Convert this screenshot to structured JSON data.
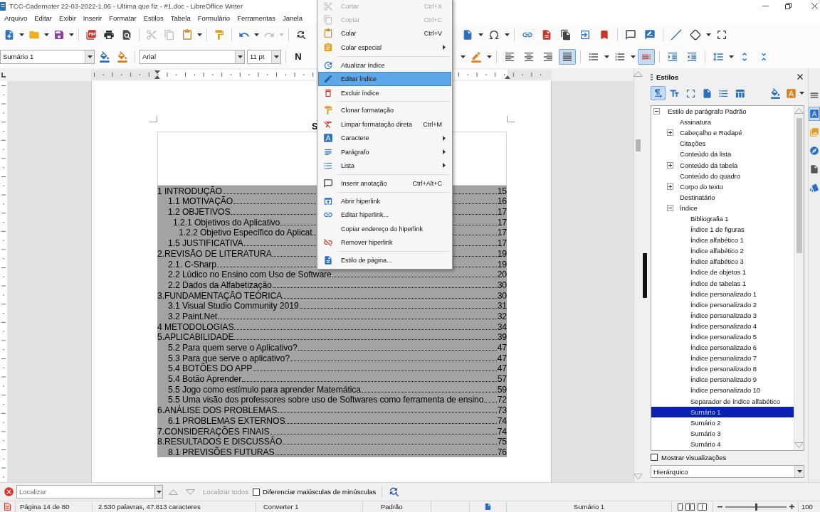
{
  "window": {
    "title": "TCC-Cadernoter 22-03-2022-1.06 - Ultima que fiz - #1.doc - LibreOffice Writer"
  },
  "menu_bar": [
    "Arquivo",
    "Editar",
    "Exibir",
    "Inserir",
    "Formatar",
    "Estilos",
    "Tabela",
    "Formulário",
    "Ferramentas",
    "Janela"
  ],
  "standard_toolbar": {
    "left_groups": [
      [
        {
          "kind": "new",
          "disabled": false
        },
        {
          "kind": "open",
          "disabled": false
        },
        {
          "kind": "save",
          "disabled": false
        }
      ],
      [
        {
          "kind": "export-pdf",
          "disabled": false
        },
        {
          "kind": "print",
          "disabled": false
        },
        {
          "kind": "print-preview",
          "disabled": false
        }
      ],
      [
        {
          "kind": "cut",
          "disabled": true
        },
        {
          "kind": "copy",
          "disabled": true
        },
        {
          "kind": "paste",
          "disabled": false
        }
      ],
      [
        {
          "kind": "clone-formatting",
          "disabled": false
        }
      ],
      [
        {
          "kind": "undo",
          "disabled": false
        },
        {
          "kind": "redo",
          "disabled": true
        }
      ],
      [
        {
          "kind": "find-replace",
          "disabled": false
        }
      ]
    ],
    "right_groups": [
      [
        {
          "kind": "insert-field",
          "disabled": false
        },
        {
          "kind": "special-character",
          "disabled": false
        }
      ],
      [
        {
          "kind": "hyperlink",
          "disabled": false
        },
        {
          "kind": "footnote",
          "disabled": false
        },
        {
          "kind": "endnote",
          "disabled": false
        },
        {
          "kind": "cross-reference",
          "disabled": false
        },
        {
          "kind": "bookmark",
          "disabled": false
        }
      ],
      [
        {
          "kind": "comment",
          "disabled": false
        },
        {
          "kind": "track-changes",
          "disabled": false
        }
      ],
      [
        {
          "kind": "line",
          "disabled": false
        },
        {
          "kind": "shapes",
          "disabled": false
        },
        {
          "kind": "frame",
          "disabled": false
        }
      ]
    ]
  },
  "formatting_toolbar": {
    "paragraph_style": "Sumário 1",
    "style_buttons": [
      {
        "kind": "update-style",
        "disabled": false
      },
      {
        "kind": "new-style",
        "disabled": false
      }
    ],
    "font_name": "Arial",
    "font_size": "11 pt",
    "bold": {
      "label": "N",
      "selected": false
    },
    "right_groups": [
      [
        {
          "kind": "highlight",
          "selected": false
        }
      ],
      [
        {
          "kind": "align-left",
          "selected": false
        },
        {
          "kind": "align-center",
          "selected": false
        },
        {
          "kind": "align-right",
          "selected": false
        },
        {
          "kind": "justify",
          "selected": true
        }
      ],
      [
        {
          "kind": "bullets",
          "selected": false
        },
        {
          "kind": "numbering",
          "selected": false
        },
        {
          "kind": "outline",
          "selected": true
        }
      ],
      [
        {
          "kind": "indent-increase",
          "selected": false
        },
        {
          "kind": "indent-decrease",
          "selected": false
        }
      ],
      [
        {
          "kind": "line-spacing",
          "selected": false
        },
        {
          "kind": "spacing-increase",
          "selected": false
        },
        {
          "kind": "spacing-decrease",
          "selected": false
        }
      ]
    ]
  },
  "document": {
    "heading": "S",
    "toc": [
      {
        "text": "1 INTRODUÇÃO",
        "page": "15",
        "children": [
          {
            "text": "1.1 MOTIVAÇÃO",
            "page": "16"
          },
          {
            "text": "1.2 OBJETIVOS",
            "page": "17",
            "children": [
              {
                "text": "1.2.1 Objetivos do Aplicativo",
                "page": "17",
                "children": [
                  {
                    "text": "1.2.2 Objetivo Específico do Aplicat",
                    "page": "17"
                  }
                ]
              }
            ]
          },
          {
            "text": "1.5 JUSTIFICATIVA",
            "page": "17"
          }
        ]
      },
      {
        "text": "2.REVISÃO DE LITERATURA",
        "page": "19",
        "children": [
          {
            "text": "2.1. C-Sharp",
            "page": "19"
          },
          {
            "text": "2.2 Lúdico no Ensino com Uso de Software",
            "page": "20"
          },
          {
            "text": "2.2 Dados da Alfabetização",
            "page": "30"
          }
        ]
      },
      {
        "text": "3.FUNDAMENTAÇÃO TEÓRICA",
        "page": "30",
        "children": [
          {
            "text": "3.1 Visual Studio Community 2019",
            "page": "31"
          },
          {
            "text": "3.2 Paint.Net",
            "page": "32"
          }
        ]
      },
      {
        "text": "4 METODOLOGIAS",
        "page": "34"
      },
      {
        "text": "5.APLICABILIDADE",
        "page": "39",
        "children": [
          {
            "text": "5.2 Para quem serve o Aplicativo?",
            "page": "47"
          },
          {
            "text": "5.3 Para que serve o aplicativo?",
            "page": "47"
          },
          {
            "text": "5.4 BOTÕES DO APP",
            "page": "47"
          },
          {
            "text": "5.4 Botão Aprender",
            "page": "57"
          },
          {
            "text": "5.5 Jogo como estímulo para aprender Matemática",
            "page": "59"
          },
          {
            "text": "5.5 Uma visão dos professores sobre uso de Softwares como ferramenta de ensino",
            "page": "72"
          }
        ]
      },
      {
        "text": "6.ANÁLISE DOS PROBLEMAS",
        "page": "73",
        "children": [
          {
            "text": "6.1 PROBLEMAS EXTERNOS",
            "page": "74"
          }
        ]
      },
      {
        "text": "7.CONSIDERAÇÕES FINAIS",
        "page": "74"
      },
      {
        "text": "8.RESULTADOS E DISCUSSÃO",
        "page": "75",
        "children": [
          {
            "text": "8.1 PREVISÕES FUTURAS",
            "page": "76"
          }
        ]
      }
    ]
  },
  "context_menu": {
    "items": [
      {
        "kind": "item",
        "label": "Cortar",
        "shortcut": "Ctrl+X",
        "submenu": false,
        "disabled": true,
        "selected": false
      },
      {
        "kind": "item",
        "label": "Copiar",
        "shortcut": "Ctrl+C",
        "submenu": false,
        "disabled": true,
        "selected": false
      },
      {
        "kind": "item",
        "label": "Colar",
        "shortcut": "Ctrl+V",
        "submenu": false,
        "disabled": false,
        "selected": false
      },
      {
        "kind": "item",
        "label": "Colar especial",
        "submenu": true,
        "disabled": false,
        "selected": false
      },
      {
        "kind": "separator"
      },
      {
        "kind": "item",
        "label": "Atualizar índice",
        "submenu": false,
        "disabled": false,
        "selected": false
      },
      {
        "kind": "item",
        "label": "Editar índice",
        "submenu": false,
        "disabled": false,
        "selected": true
      },
      {
        "kind": "item",
        "label": "Excluir índice",
        "submenu": false,
        "disabled": false,
        "selected": false
      },
      {
        "kind": "separator"
      },
      {
        "kind": "item",
        "label": "Clonar formatação",
        "submenu": false,
        "disabled": false,
        "selected": false
      },
      {
        "kind": "item",
        "label": "Limpar formatação direta",
        "shortcut": "Ctrl+M",
        "submenu": false,
        "disabled": false,
        "selected": false
      },
      {
        "kind": "item",
        "label": "Caractere",
        "submenu": true,
        "disabled": false,
        "selected": false
      },
      {
        "kind": "item",
        "label": "Parágrafo",
        "submenu": true,
        "disabled": false,
        "selected": false
      },
      {
        "kind": "item",
        "label": "Lista",
        "submenu": true,
        "disabled": false,
        "selected": false
      },
      {
        "kind": "separator"
      },
      {
        "kind": "item",
        "label": "Inserir anotação",
        "shortcut": "Ctrl+Alt+C",
        "submenu": false,
        "disabled": false,
        "selected": false
      },
      {
        "kind": "separator"
      },
      {
        "kind": "item",
        "label": "Abrir hiperlink",
        "submenu": false,
        "disabled": false,
        "selected": false
      },
      {
        "kind": "item",
        "label": "Editar hiperlink...",
        "submenu": false,
        "disabled": false,
        "selected": false
      },
      {
        "kind": "item",
        "label": "Copiar endereço do hiperlink",
        "submenu": false,
        "disabled": false,
        "selected": false
      },
      {
        "kind": "item",
        "label": "Remover hiperlink",
        "submenu": false,
        "disabled": false,
        "selected": false
      },
      {
        "kind": "separator"
      },
      {
        "kind": "item",
        "label": "Estilo de página...",
        "submenu": false,
        "disabled": false,
        "selected": false
      }
    ]
  },
  "styles_panel": {
    "title": "Estilos",
    "families": [
      {
        "kind": "paragraph",
        "selected": true
      },
      {
        "kind": "character",
        "selected": false
      },
      {
        "kind": "frame",
        "selected": false
      },
      {
        "kind": "page",
        "selected": false
      },
      {
        "kind": "list",
        "selected": false
      },
      {
        "kind": "table",
        "selected": false
      }
    ],
    "tree": [
      {
        "label": "Estilo de parágrafo Padrão",
        "expanded": true,
        "selected": false,
        "children": [
          {
            "label": "Assinatura",
            "selected": false
          },
          {
            "label": "Cabeçalho e Rodapé",
            "expanded": false,
            "selected": false
          },
          {
            "label": "Citações",
            "selected": false
          },
          {
            "label": "Conteúdo da lista",
            "selected": false
          },
          {
            "label": "Conteúdo da tabela",
            "expanded": false,
            "selected": false
          },
          {
            "label": "Conteúdo do quadro",
            "selected": false
          },
          {
            "label": "Corpo do texto",
            "expanded": false,
            "selected": false
          },
          {
            "label": "Destinatário",
            "selected": false
          },
          {
            "label": "Índice",
            "expanded": true,
            "selected": false,
            "children": [
              {
                "label": "Bibliografia 1",
                "selected": false
              },
              {
                "label": "Índice 1 de figuras",
                "selected": false
              },
              {
                "label": "Índice alfabético 1",
                "selected": false
              },
              {
                "label": "Índice alfabético 2",
                "selected": false
              },
              {
                "label": "Índice alfabético 3",
                "selected": false
              },
              {
                "label": "Índice de objetos 1",
                "selected": false
              },
              {
                "label": "Índice de tabelas 1",
                "selected": false
              },
              {
                "label": "Índice personalizado 1",
                "selected": false
              },
              {
                "label": "Índice personalizado 2",
                "selected": false
              },
              {
                "label": "Índice personalizado 3",
                "selected": false
              },
              {
                "label": "Índice personalizado 4",
                "selected": false
              },
              {
                "label": "Índice personalizado 5",
                "selected": false
              },
              {
                "label": "Índice personalizado 6",
                "selected": false
              },
              {
                "label": "Índice personalizado 7",
                "selected": false
              },
              {
                "label": "Índice personalizado 8",
                "selected": false
              },
              {
                "label": "Índice personalizado 9",
                "selected": false
              },
              {
                "label": "Índice personalizado 10",
                "selected": false
              },
              {
                "label": "Separador de índice alfabético",
                "selected": false
              },
              {
                "label": "Sumário 1",
                "selected": true
              },
              {
                "label": "Sumário 2",
                "selected": false
              },
              {
                "label": "Sumário 3",
                "selected": false
              },
              {
                "label": "Sumário 4",
                "selected": false
              }
            ]
          }
        ]
      }
    ],
    "show_previews": {
      "label": "Mostrar visualizações",
      "checked": false
    },
    "filter": "Hierárquico"
  },
  "sidebar_tabs": [
    {
      "kind": "menu",
      "selected": false
    },
    {
      "kind": "styles",
      "selected": true
    },
    {
      "kind": "gallery",
      "selected": false
    },
    {
      "kind": "navigator",
      "selected": false
    },
    {
      "kind": "page",
      "selected": false
    },
    {
      "kind": "style-inspector",
      "selected": false
    }
  ],
  "find_bar": {
    "placeholder": "Localizar",
    "find_all": {
      "label": "Localizar todos",
      "disabled": true
    },
    "match_case": {
      "label": "Diferenciar maiúsculas de minúsculas",
      "checked": false
    }
  },
  "status_bar": {
    "page": "Página 14 de 80",
    "words": "2.530 palavras, 47.813 caracteres",
    "page_style": "Converter 1",
    "language": "Padrão",
    "object": "Sumário 1",
    "zoom": {
      "level": 0.5
    },
    "zoom_value": "100"
  }
}
